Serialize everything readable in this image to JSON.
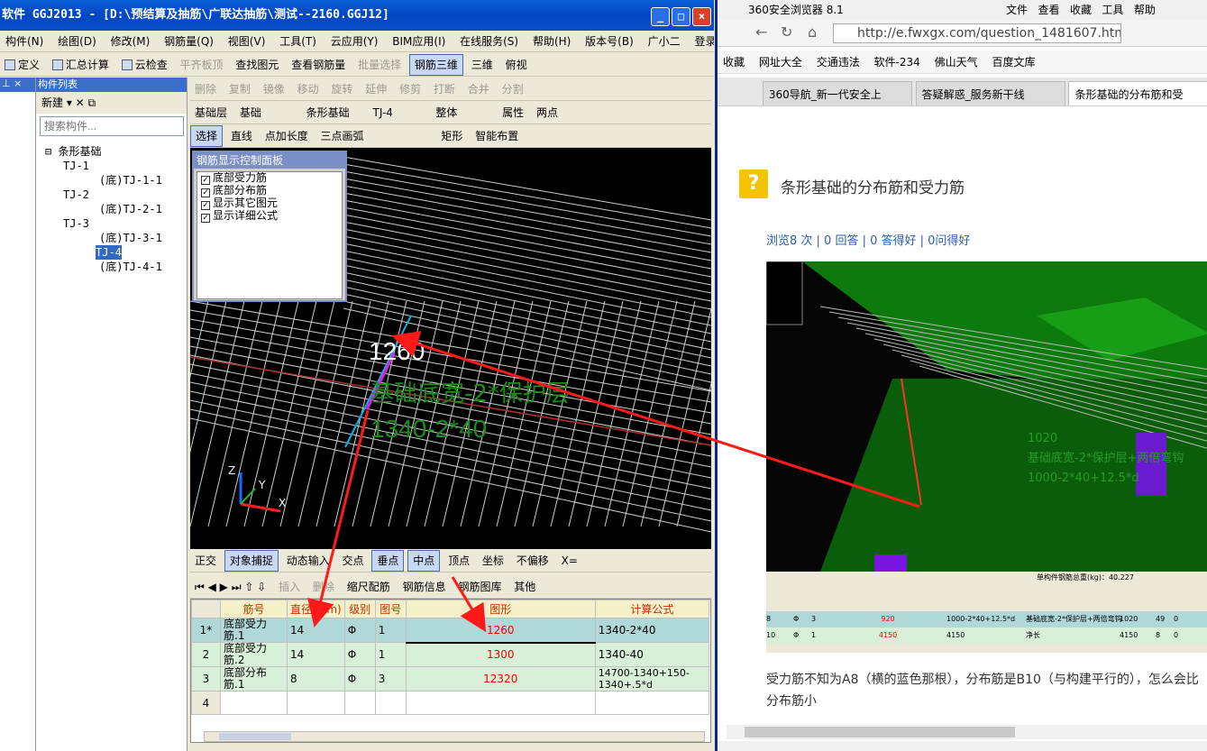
{
  "app": {
    "title": "软件 GGJ2013 - [D:\\预结算及抽筋\\广联达抽筋\\测试--2160.GGJ12]",
    "window_buttons": [
      "_",
      "□",
      "×"
    ],
    "menu": [
      "构件(N)",
      "绘图(D)",
      "修改(M)",
      "钢筋量(Q)",
      "视图(V)",
      "工具(T)",
      "云应用(Y)",
      "BIM应用(I)",
      "在线服务(S)",
      "帮助(H)",
      "版本号(B)",
      "广小二",
      "登录"
    ],
    "toolbar1": [
      "定义",
      "汇总计算",
      "云检查",
      "平齐板顶",
      "查找图元",
      "查看钢筋量",
      "批量选择",
      "钢筋三维",
      "三维",
      "俯视"
    ],
    "toolbar2": [
      "删除",
      "复制",
      "镜像",
      "移动",
      "旋转",
      "延伸",
      "修剪",
      "打断",
      "合并",
      "分割"
    ],
    "toolbar3": [
      "基础层",
      "基础",
      "条形基础",
      "TJ-4",
      "整体",
      "属性",
      "两点"
    ],
    "toolbar4": [
      "选择",
      "直线",
      "点加长度",
      "三点画弧",
      "矩形",
      "智能布置"
    ],
    "snapbar": [
      "正交",
      "对象捕捉",
      "动态输入",
      "交点",
      "垂点",
      "中点",
      "顶点",
      "坐标",
      "不偏移",
      "X="
    ],
    "tablebar": [
      "插入",
      "删除",
      "缩尺配筋",
      "钢筋信息",
      "钢筋图库",
      "其他"
    ],
    "component_list": {
      "header": "构件列表",
      "new_label": "新建",
      "search_placeholder": "搜索构件...",
      "root": "条形基础",
      "items": [
        "TJ-1",
        "(底)TJ-1-1",
        "TJ-2",
        "(底)TJ-2-1",
        "TJ-3",
        "(底)TJ-3-1",
        "TJ-4",
        "(底)TJ-4-1"
      ]
    },
    "control_panel": {
      "title": "钢筋显示控制面板",
      "options": [
        "底部受力筋",
        "底部分布筋",
        "显示其它图元",
        "显示详细公式"
      ]
    },
    "viewport": {
      "dim_value": "1260",
      "formula_desc": "基础底宽-2*保护层",
      "formula": "1340-2*40"
    },
    "rebar_table": {
      "headers": [
        "",
        "筋号",
        "直径(mm)",
        "级别",
        "图号",
        "图形",
        "计算公式"
      ],
      "rows": [
        {
          "no": "1*",
          "name": "底部受力筋.1",
          "dia": "14",
          "grade": "Φ",
          "fig": "1",
          "shape": "1260",
          "formula": "1340-2*40"
        },
        {
          "no": "2",
          "name": "底部受力筋.2",
          "dia": "14",
          "grade": "Φ",
          "fig": "1",
          "shape": "1300",
          "formula": "1340-40"
        },
        {
          "no": "3",
          "name": "底部分布筋.1",
          "dia": "8",
          "grade": "Φ",
          "fig": "3",
          "shape": "12320",
          "formula": "14700-1340+150-1340+.5*d"
        },
        {
          "no": "4",
          "name": "",
          "dia": "",
          "grade": "",
          "fig": "",
          "shape": "",
          "formula": ""
        }
      ]
    }
  },
  "browser": {
    "title": "360安全浏览器 8.1",
    "menu": [
      "文件",
      "查看",
      "收藏",
      "工具",
      "帮助"
    ],
    "url": "http://e.fwxgx.com/question_1481607.htm",
    "favorites": [
      "收藏",
      "网址大全",
      "交通违法",
      "软件-234",
      "佛山天气",
      "百度文库"
    ],
    "tabs": [
      "360导航_新一代安全上",
      "答疑解惑_服务新干线",
      "条形基础的分布筋和受"
    ],
    "question_title": "条形基础的分布筋和受力筋",
    "stats": "浏览8 次 | 0 回答 | 0 答得好 | 0问得好",
    "body_text": "受力筋不知为A8（横的蓝色那根），分布筋是B10（与构建平行的），怎么会比分布筋小",
    "inset": {
      "text1": "1020",
      "text2": "基础底宽-2*保护层+两倍弯钩",
      "text3": "1000-2*40+12.5*d",
      "summary": "单构件钢筋总重(kg)：40.227",
      "rows": [
        {
          "dia": "8",
          "grade": "Φ",
          "fig": "3",
          "shape": "920",
          "formula": "1000-2*40+12.5*d",
          "desc": "基础底宽-2*保护层+两倍弯钩",
          "len": "1020",
          "count": "49",
          "x": "0"
        },
        {
          "dia": "10",
          "grade": "Φ",
          "fig": "1",
          "shape": "4150",
          "formula": "4150",
          "desc": "净长",
          "len": "4150",
          "count": "8",
          "x": "0"
        }
      ]
    }
  },
  "colors": {
    "title_blue": "#0a5fd8",
    "arrow_red": "#ff1a1a",
    "table_sel": "#b0d8d8",
    "dim_green": "#1c8c1c"
  }
}
